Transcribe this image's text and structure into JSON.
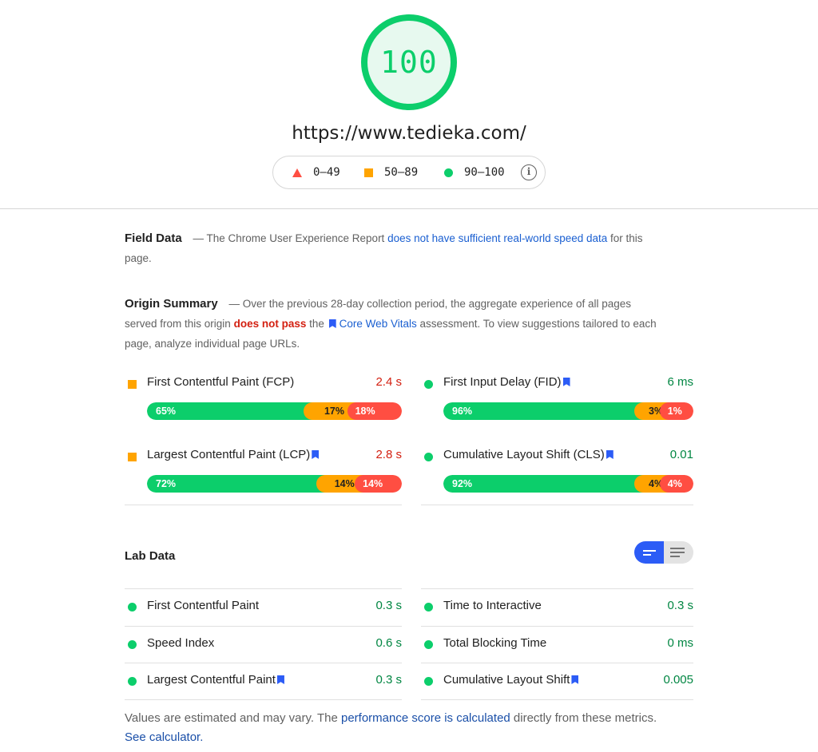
{
  "header": {
    "score": "100",
    "url": "https://www.tedieka.com/",
    "legend": [
      {
        "icon": "triangle-fail-icon",
        "label": "0–49",
        "color": "#ff4e42"
      },
      {
        "icon": "square-average-icon",
        "label": "50–89",
        "color": "#ffa400"
      },
      {
        "icon": "circle-pass-icon",
        "label": "90–100",
        "color": "#0cce6b"
      }
    ],
    "info_icon": "info-icon",
    "info_glyph": "i"
  },
  "field_data": {
    "title": "Field Data",
    "dash": "—",
    "text_before": "The Chrome User Experience Report",
    "link": "does not have sufficient real-world speed data",
    "text_after": "for this page."
  },
  "origin_summary": {
    "title": "Origin Summary",
    "dash": "—",
    "text1": "Over the previous 28-day collection period, the aggregate experience of all pages served from this origin",
    "fail_text": "does not pass",
    "text2": "the",
    "link": "Core Web Vitals",
    "text3": "assessment. To view suggestions tailored to each page, analyze individual page URLs.",
    "metrics": [
      {
        "label": "First Contentful Paint (FCP)",
        "value": "2.4 s",
        "rating": "average",
        "bookmark": false,
        "distribution": {
          "good": "65%",
          "needs_improvement": "17%",
          "poor": "18%"
        }
      },
      {
        "label": "First Input Delay (FID)",
        "value": "6 ms",
        "rating": "pass",
        "bookmark": true,
        "distribution": {
          "good": "96%",
          "needs_improvement": "3%",
          "poor": "1%"
        }
      },
      {
        "label": "Largest Contentful Paint (LCP)",
        "value": "2.8 s",
        "rating": "average",
        "bookmark": true,
        "distribution": {
          "good": "72%",
          "needs_improvement": "14%",
          "poor": "14%"
        }
      },
      {
        "label": "Cumulative Layout Shift (CLS)",
        "value": "0.01",
        "rating": "pass",
        "bookmark": true,
        "distribution": {
          "good": "92%",
          "needs_improvement": "4%",
          "poor": "4%"
        }
      }
    ]
  },
  "lab_data": {
    "title": "Lab Data",
    "view_toggle": [
      "compact-view-icon",
      "expanded-view-icon"
    ],
    "metrics": [
      {
        "label": "First Contentful Paint",
        "value": "0.3 s",
        "bookmark": false
      },
      {
        "label": "Time to Interactive",
        "value": "0.3 s",
        "bookmark": false
      },
      {
        "label": "Speed Index",
        "value": "0.6 s",
        "bookmark": false
      },
      {
        "label": "Total Blocking Time",
        "value": "0 ms",
        "bookmark": false
      },
      {
        "label": "Largest Contentful Paint",
        "value": "0.3 s",
        "bookmark": true
      },
      {
        "label": "Cumulative Layout Shift",
        "value": "0.005",
        "bookmark": true
      }
    ]
  },
  "footer": {
    "text1": "Values are estimated and may vary. The",
    "link1": "performance score is calculated",
    "text2": "directly from these metrics.",
    "link2": "See calculator."
  },
  "colors": {
    "pass": "#0cce6b",
    "average": "#ffa400",
    "fail": "#ff4e42",
    "link": "#1a5fd1",
    "bookmark": "#2c5cf6"
  }
}
